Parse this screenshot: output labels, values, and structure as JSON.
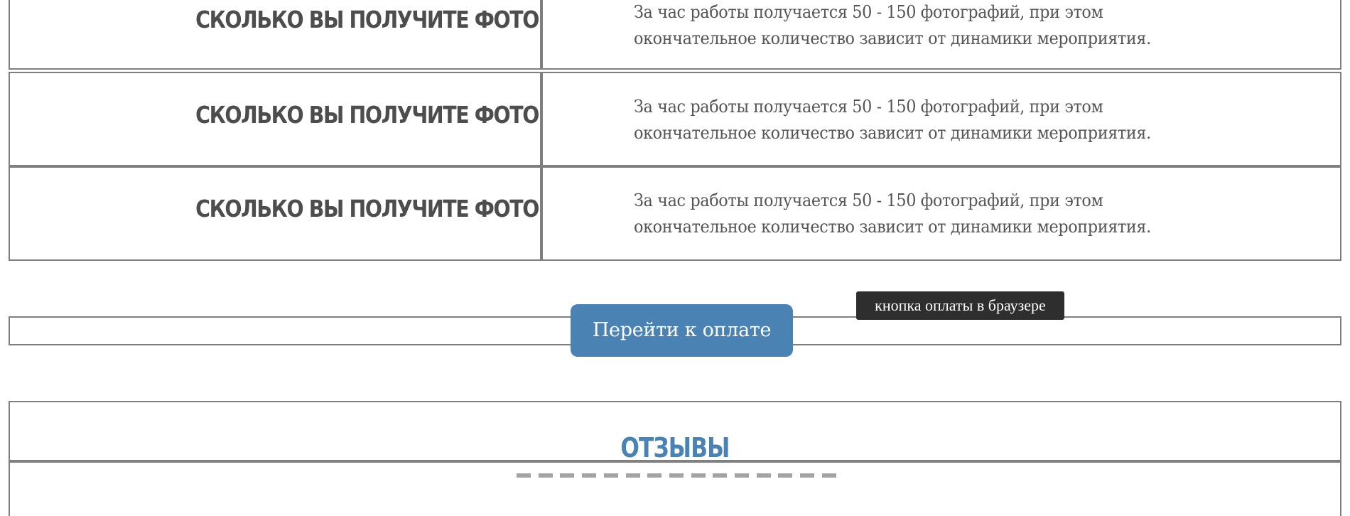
{
  "faq": {
    "rows": [
      {
        "title": "СКОЛЬКО ВЫ ПОЛУЧИТЕ ФОТО",
        "line1": "За час работы получается 50 - 150 фотографий, при этом",
        "line2": "окончательное количество зависит от динамики мероприятия."
      },
      {
        "title": "СКОЛЬКО ВЫ ПОЛУЧИТЕ ФОТО",
        "line1": "За час работы получается 50 - 150 фотографий, при этом",
        "line2": "окончательное количество зависит от динамики мероприятия."
      },
      {
        "title": "СКОЛЬКО ВЫ ПОЛУЧИТЕ ФОТО",
        "line1": "За час работы получается 50 - 150 фотографий, при этом",
        "line2": "окончательное количество зависит от динамики мероприятия."
      }
    ]
  },
  "payment": {
    "button_label": "Перейти к оплате",
    "tooltip": "кнопка оплаты в браузере"
  },
  "reviews": {
    "title": "ОТЗЫВЫ"
  },
  "colors": {
    "accent": "#4a82b4",
    "border": "#7f7f7f",
    "heading_text": "#4d4d4d",
    "body_text": "#555555",
    "tooltip_bg": "#2e2e2e",
    "divider": "#a3a3a3"
  }
}
